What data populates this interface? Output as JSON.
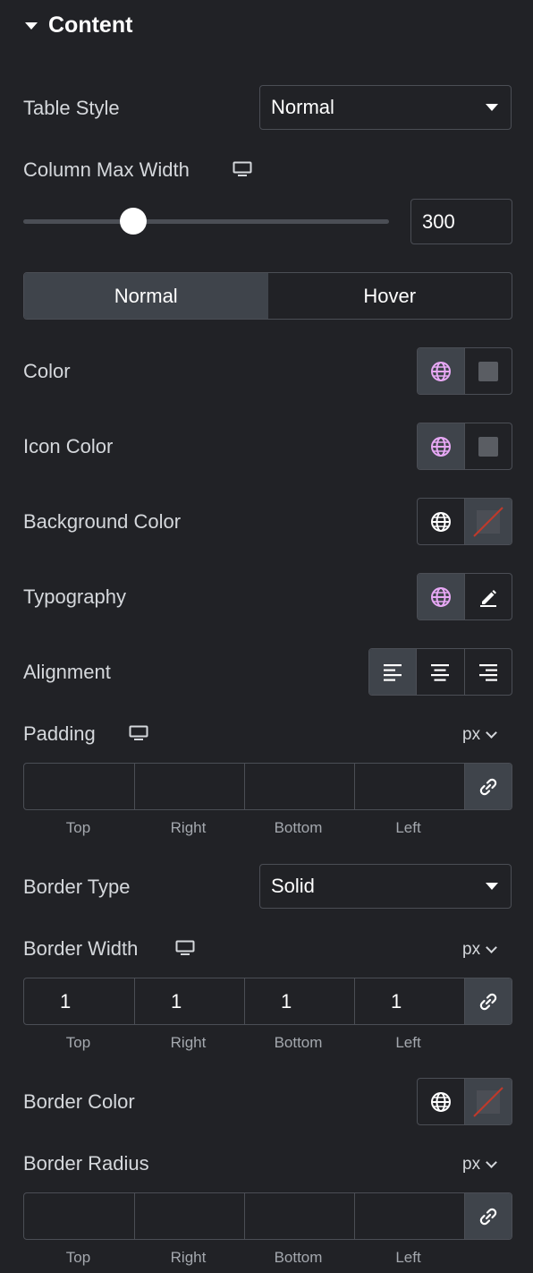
{
  "section": {
    "title": "Content"
  },
  "table_style": {
    "label": "Table Style",
    "value": "Normal"
  },
  "column_max_width": {
    "label": "Column Max Width",
    "value": "300",
    "slider_fraction": 0.3
  },
  "state_tabs": {
    "normal": "Normal",
    "hover": "Hover",
    "active": "Normal"
  },
  "color": {
    "label": "Color"
  },
  "icon_color": {
    "label": "Icon Color"
  },
  "background_color": {
    "label": "Background Color"
  },
  "typography": {
    "label": "Typography"
  },
  "alignment": {
    "label": "Alignment",
    "options": [
      "left",
      "center",
      "right"
    ],
    "selected": "left"
  },
  "padding": {
    "label": "Padding",
    "unit": "px",
    "values": {
      "top": "",
      "right": "",
      "bottom": "",
      "left": ""
    },
    "labels": {
      "top": "Top",
      "right": "Right",
      "bottom": "Bottom",
      "left": "Left"
    }
  },
  "border_type": {
    "label": "Border Type",
    "value": "Solid"
  },
  "border_width": {
    "label": "Border Width",
    "unit": "px",
    "values": {
      "top": "1",
      "right": "1",
      "bottom": "1",
      "left": "1"
    },
    "labels": {
      "top": "Top",
      "right": "Right",
      "bottom": "Bottom",
      "left": "Left"
    }
  },
  "border_color": {
    "label": "Border Color"
  },
  "border_radius": {
    "label": "Border Radius",
    "unit": "px",
    "values": {
      "top": "",
      "right": "",
      "bottom": "",
      "left": ""
    },
    "labels": {
      "top": "Top",
      "right": "Right",
      "bottom": "Bottom",
      "left": "Left"
    }
  },
  "colors": {
    "panel_bg": "#212226",
    "active_bg": "#3f444b",
    "border": "#4b4e55",
    "global_icon_active": "#e7a8f5",
    "swatch": "#5a5d63",
    "none_slash": "#c0392b"
  }
}
